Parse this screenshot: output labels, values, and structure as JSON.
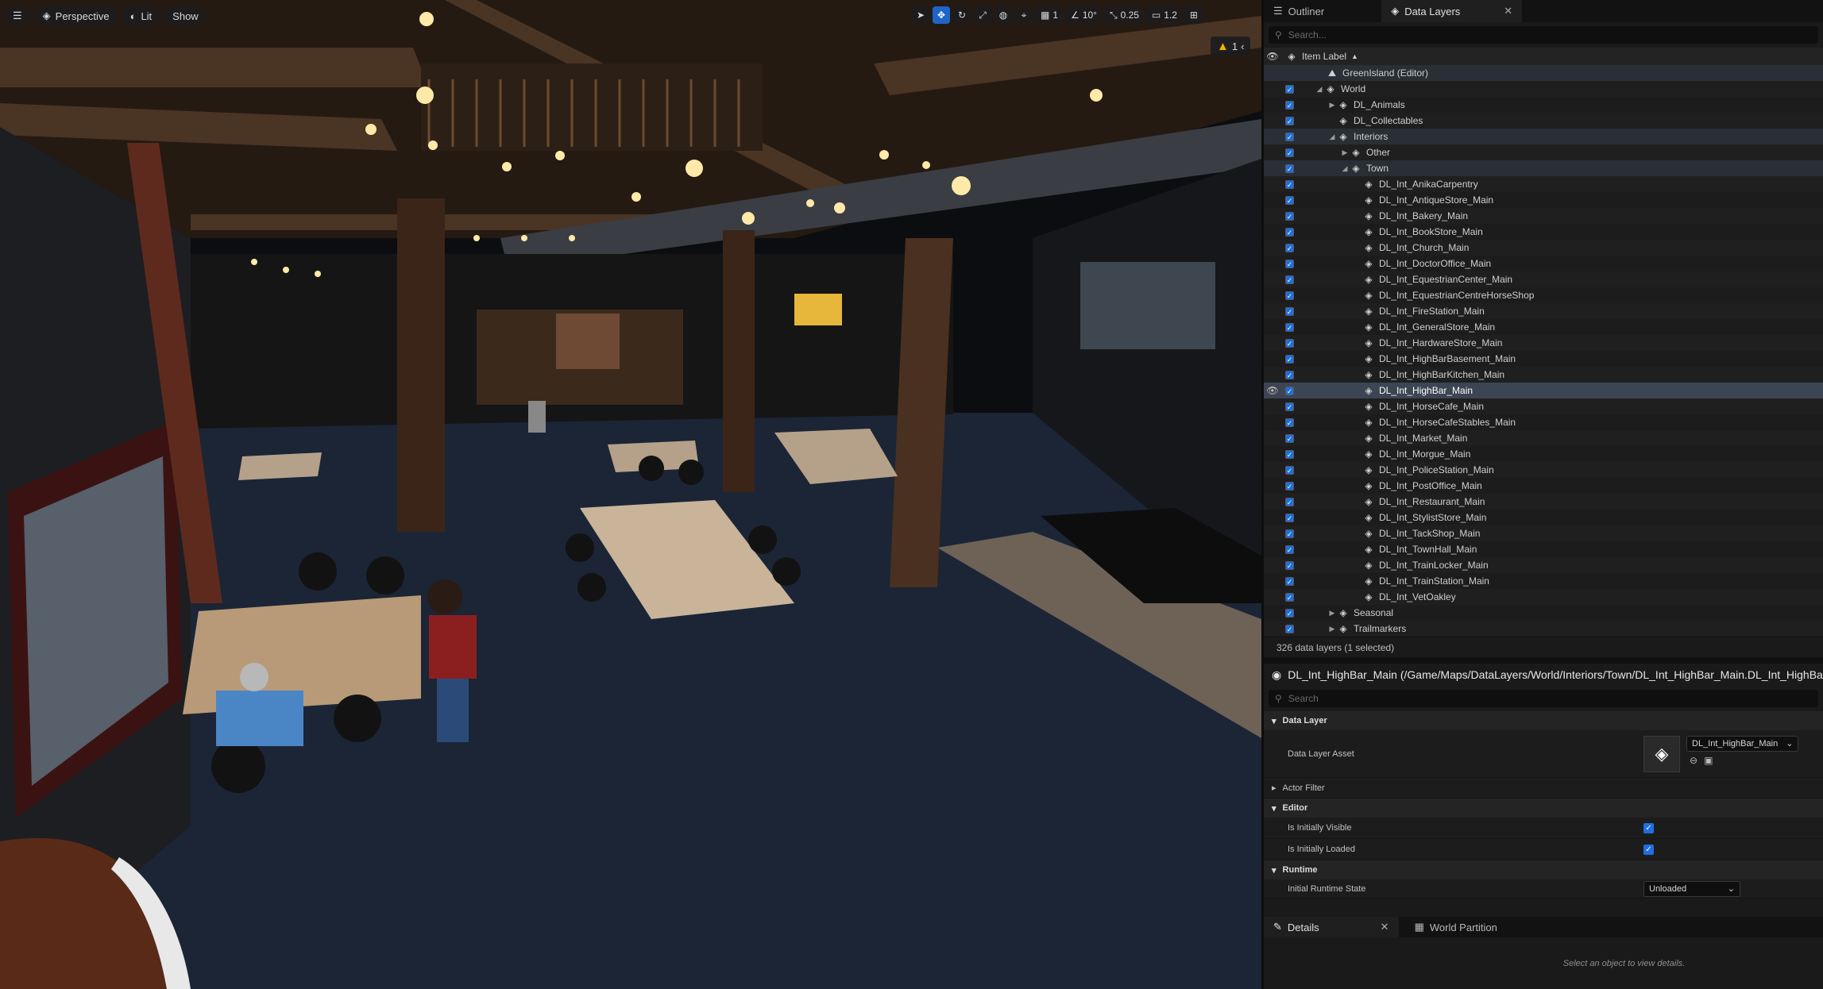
{
  "viewport": {
    "perspective_label": "Perspective",
    "lit_label": "Lit",
    "show_label": "Show",
    "grid_value": "1",
    "angle_value": "10°",
    "scale_value": "0.25",
    "camera_speed_value": "1.2",
    "warning_count": "1"
  },
  "outliner": {
    "tab_outliner": "Outliner",
    "tab_data_layers": "Data Layers",
    "search_placeholder": "Search...",
    "column_header": "Item Label",
    "rows": [
      {
        "label": "GreenIsland (Editor)",
        "depth": 0,
        "arrow": "",
        "icon": "world-icon"
      },
      {
        "label": "World",
        "depth": 1,
        "arrow": "down"
      },
      {
        "label": "DL_Animals",
        "depth": 2,
        "arrow": "right"
      },
      {
        "label": "DL_Collectables",
        "depth": 2,
        "arrow": ""
      },
      {
        "label": "Interiors",
        "depth": 2,
        "arrow": "down"
      },
      {
        "label": "Other",
        "depth": 3,
        "arrow": "right"
      },
      {
        "label": "Town",
        "depth": 3,
        "arrow": "down"
      },
      {
        "label": "DL_Int_AnikaCarpentry",
        "depth": 4,
        "arrow": ""
      },
      {
        "label": "DL_Int_AntiqueStore_Main",
        "depth": 4,
        "arrow": ""
      },
      {
        "label": "DL_Int_Bakery_Main",
        "depth": 4,
        "arrow": ""
      },
      {
        "label": "DL_Int_BookStore_Main",
        "depth": 4,
        "arrow": ""
      },
      {
        "label": "DL_Int_Church_Main",
        "depth": 4,
        "arrow": ""
      },
      {
        "label": "DL_Int_DoctorOffice_Main",
        "depth": 4,
        "arrow": ""
      },
      {
        "label": "DL_Int_EquestrianCenter_Main",
        "depth": 4,
        "arrow": ""
      },
      {
        "label": "DL_Int_EquestrianCentreHorseShop",
        "depth": 4,
        "arrow": ""
      },
      {
        "label": "DL_Int_FireStation_Main",
        "depth": 4,
        "arrow": ""
      },
      {
        "label": "DL_Int_GeneralStore_Main",
        "depth": 4,
        "arrow": ""
      },
      {
        "label": "DL_Int_HardwareStore_Main",
        "depth": 4,
        "arrow": ""
      },
      {
        "label": "DL_Int_HighBarBasement_Main",
        "depth": 4,
        "arrow": ""
      },
      {
        "label": "DL_Int_HighBarKitchen_Main",
        "depth": 4,
        "arrow": ""
      },
      {
        "label": "DL_Int_HighBar_Main",
        "depth": 4,
        "arrow": "",
        "selected": true
      },
      {
        "label": "DL_Int_HorseCafe_Main",
        "depth": 4,
        "arrow": ""
      },
      {
        "label": "DL_Int_HorseCafeStables_Main",
        "depth": 4,
        "arrow": ""
      },
      {
        "label": "DL_Int_Market_Main",
        "depth": 4,
        "arrow": ""
      },
      {
        "label": "DL_Int_Morgue_Main",
        "depth": 4,
        "arrow": ""
      },
      {
        "label": "DL_Int_PoliceStation_Main",
        "depth": 4,
        "arrow": ""
      },
      {
        "label": "DL_Int_PostOffice_Main",
        "depth": 4,
        "arrow": ""
      },
      {
        "label": "DL_Int_Restaurant_Main",
        "depth": 4,
        "arrow": ""
      },
      {
        "label": "DL_Int_StylistStore_Main",
        "depth": 4,
        "arrow": ""
      },
      {
        "label": "DL_Int_TackShop_Main",
        "depth": 4,
        "arrow": ""
      },
      {
        "label": "DL_Int_TownHall_Main",
        "depth": 4,
        "arrow": ""
      },
      {
        "label": "DL_Int_TrainLocker_Main",
        "depth": 4,
        "arrow": ""
      },
      {
        "label": "DL_Int_TrainStation_Main",
        "depth": 4,
        "arrow": ""
      },
      {
        "label": "DL_Int_VetOakley",
        "depth": 4,
        "arrow": ""
      },
      {
        "label": "Seasonal",
        "depth": 2,
        "arrow": "right"
      },
      {
        "label": "Trailmarkers",
        "depth": 2,
        "arrow": "right"
      }
    ],
    "status": "326 data layers (1 selected)"
  },
  "details": {
    "title": "DL_Int_HighBar_Main (/Game/Maps/DataLayers/World/Interiors/Town/DL_Int_HighBar_Main.DL_Int_HighBar_Main)",
    "search_placeholder": "Search",
    "section_data_layer": "Data Layer",
    "data_layer_asset_label": "Data Layer Asset",
    "data_layer_asset_value": "DL_Int_HighBar_Main",
    "actor_filter_label": "Actor Filter",
    "section_editor": "Editor",
    "initially_visible_label": "Is Initially Visible",
    "initially_visible": true,
    "initially_loaded_label": "Is Initially Loaded",
    "initially_loaded": true,
    "section_runtime": "Runtime",
    "runtime_state_label": "Initial Runtime State",
    "runtime_state_value": "Unloaded"
  },
  "bottom_tabs": {
    "details": "Details",
    "world_partition": "World Partition",
    "empty_hint": "Select an object to view details."
  },
  "colors": {
    "accent": "#1f6fe0",
    "selection": "#3c4554",
    "warning": "#f0b400"
  }
}
